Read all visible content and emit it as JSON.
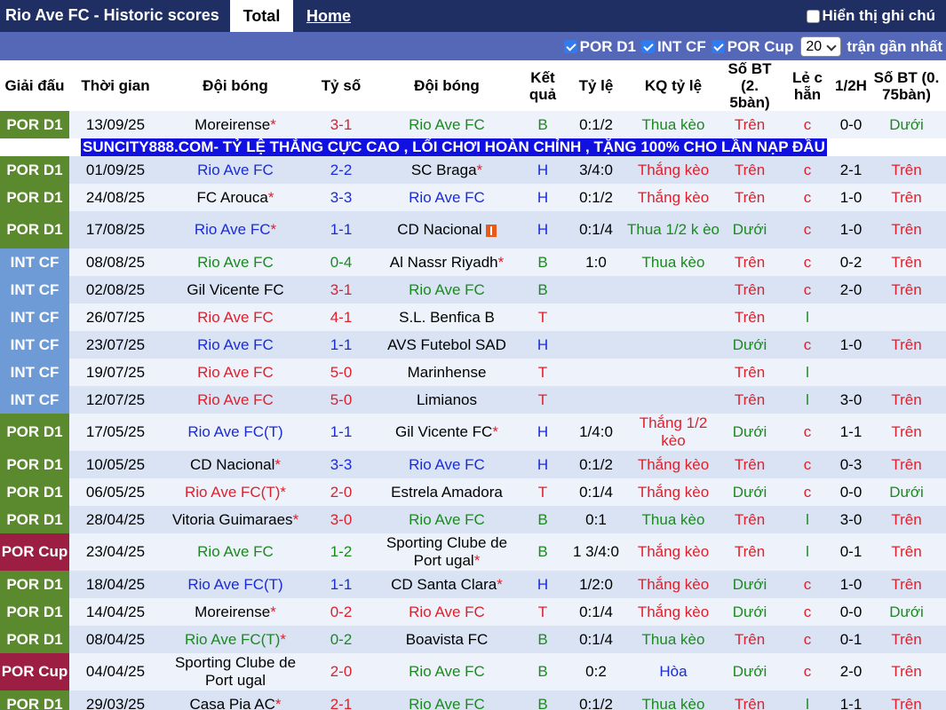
{
  "header": {
    "title": "Rio Ave FC - Historic scores",
    "tab_total": "Total",
    "tab_home": "Home",
    "notes_label": "Hiển thị ghi chú"
  },
  "filters": {
    "items": [
      "POR D1",
      "INT CF",
      "POR Cup"
    ],
    "count_value": "20",
    "count_suffix": "trận gần nhất"
  },
  "columns": [
    "Giải đấu",
    "Thời gian",
    "Đội bóng",
    "Tỷ số",
    "Đội bóng",
    "Kết quả",
    "Tỷ lệ",
    "KQ tỷ lệ",
    "Số BT (2. 5bàn)",
    "Lẻ c hẵn",
    "1/2H",
    "Số BT (0. 75bàn)"
  ],
  "ad_text": "SUNCITY888.COM- TỶ LỆ THẮNG CỰC CAO , LỐI CHƠI HOÀN CHỈNH , TẶNG 100% CHO LẦN NẠP ĐẦU",
  "colors": {
    "red": "#e01f2b",
    "blue": "#1a2bd8",
    "green": "#1a8a1e",
    "por": "#5b8a2e",
    "int": "#6e9ad6",
    "cup": "#9c1e42"
  },
  "rows": [
    {
      "league": "POR D1",
      "lt": "por",
      "date": "13/09/25",
      "home": "Moreirense",
      "hc": "black",
      "hstar": "*",
      "score": "3-1",
      "sc": "red",
      "away": "Rio Ave FC",
      "ac": "green",
      "astar": "",
      "res": "B",
      "rc": "green",
      "odds": "0:1/2",
      "kq": "Thua kèo",
      "kc": "green",
      "bt": "Trên",
      "bc": "red",
      "lc": "c",
      "lcc": "red",
      "half": "0-0",
      "bt2": "Dưới",
      "b2c": "green"
    },
    {
      "league": "POR D1",
      "lt": "por",
      "date": "01/09/25",
      "home": "Rio Ave FC",
      "hc": "blue",
      "hstar": "",
      "score": "2-2",
      "sc": "blue",
      "away": "SC Braga",
      "ac": "black",
      "astar": "*",
      "res": "H",
      "rc": "blue",
      "odds": "3/4:0",
      "kq": "Thắng kèo",
      "kc": "red",
      "bt": "Trên",
      "bc": "red",
      "lc": "c",
      "lcc": "red",
      "half": "2-1",
      "bt2": "Trên",
      "b2c": "red"
    },
    {
      "league": "POR D1",
      "lt": "por",
      "date": "24/08/25",
      "home": "FC Arouca",
      "hc": "black",
      "hstar": "*",
      "score": "3-3",
      "sc": "blue",
      "away": "Rio Ave FC",
      "ac": "blue",
      "astar": "",
      "res": "H",
      "rc": "blue",
      "odds": "0:1/2",
      "kq": "Thắng kèo",
      "kc": "red",
      "bt": "Trên",
      "bc": "red",
      "lc": "c",
      "lcc": "red",
      "half": "1-0",
      "bt2": "Trên",
      "b2c": "red"
    },
    {
      "league": "POR D1",
      "lt": "por",
      "date": "17/08/25",
      "home": "Rio Ave FC",
      "hc": "blue",
      "hstar": "*",
      "score": "1-1",
      "sc": "blue",
      "away": "CD Nacional",
      "ac": "black",
      "astar": "",
      "flag": true,
      "res": "H",
      "rc": "blue",
      "odds": "0:1/4",
      "kq": "Thua 1/2 k èo",
      "kc": "green",
      "bt": "Dưới",
      "bc": "green",
      "lc": "c",
      "lcc": "red",
      "half": "1-0",
      "bt2": "Trên",
      "b2c": "red",
      "tall": true
    },
    {
      "league": "INT CF",
      "lt": "int",
      "date": "08/08/25",
      "home": "Rio Ave FC",
      "hc": "green",
      "hstar": "",
      "score": "0-4",
      "sc": "green",
      "away": "Al Nassr Riyadh",
      "ac": "black",
      "astar": "*",
      "res": "B",
      "rc": "green",
      "odds": "1:0",
      "kq": "Thua kèo",
      "kc": "green",
      "bt": "Trên",
      "bc": "red",
      "lc": "c",
      "lcc": "red",
      "half": "0-2",
      "bt2": "Trên",
      "b2c": "red"
    },
    {
      "league": "INT CF",
      "lt": "int",
      "date": "02/08/25",
      "home": "Gil Vicente FC",
      "hc": "black",
      "hstar": "",
      "score": "3-1",
      "sc": "red",
      "away": "Rio Ave FC",
      "ac": "green",
      "astar": "",
      "res": "B",
      "rc": "green",
      "odds": "",
      "kq": "",
      "kc": "green",
      "bt": "Trên",
      "bc": "red",
      "lc": "c",
      "lcc": "red",
      "half": "2-0",
      "bt2": "Trên",
      "b2c": "red"
    },
    {
      "league": "INT CF",
      "lt": "int",
      "date": "26/07/25",
      "home": "Rio Ave FC",
      "hc": "red",
      "hstar": "",
      "score": "4-1",
      "sc": "red",
      "away": "S.L. Benfica B",
      "ac": "black",
      "astar": "",
      "res": "T",
      "rc": "red",
      "odds": "",
      "kq": "",
      "kc": "green",
      "bt": "Trên",
      "bc": "red",
      "lc": "l",
      "lcc": "green",
      "half": "",
      "bt2": "",
      "b2c": "red"
    },
    {
      "league": "INT CF",
      "lt": "int",
      "date": "23/07/25",
      "home": "Rio Ave FC",
      "hc": "blue",
      "hstar": "",
      "score": "1-1",
      "sc": "blue",
      "away": "AVS Futebol SAD",
      "ac": "black",
      "astar": "",
      "res": "H",
      "rc": "blue",
      "odds": "",
      "kq": "",
      "kc": "green",
      "bt": "Dưới",
      "bc": "green",
      "lc": "c",
      "lcc": "red",
      "half": "1-0",
      "bt2": "Trên",
      "b2c": "red"
    },
    {
      "league": "INT CF",
      "lt": "int",
      "date": "19/07/25",
      "home": "Rio Ave FC",
      "hc": "red",
      "hstar": "",
      "score": "5-0",
      "sc": "red",
      "away": "Marinhense",
      "ac": "black",
      "astar": "",
      "res": "T",
      "rc": "red",
      "odds": "",
      "kq": "",
      "kc": "green",
      "bt": "Trên",
      "bc": "red",
      "lc": "l",
      "lcc": "green",
      "half": "",
      "bt2": "",
      "b2c": "red"
    },
    {
      "league": "INT CF",
      "lt": "int",
      "date": "12/07/25",
      "home": "Rio Ave FC",
      "hc": "red",
      "hstar": "",
      "score": "5-0",
      "sc": "red",
      "away": "Limianos",
      "ac": "black",
      "astar": "",
      "res": "T",
      "rc": "red",
      "odds": "",
      "kq": "",
      "kc": "green",
      "bt": "Trên",
      "bc": "red",
      "lc": "l",
      "lcc": "green",
      "half": "3-0",
      "bt2": "Trên",
      "b2c": "red"
    },
    {
      "league": "POR D1",
      "lt": "por",
      "date": "17/05/25",
      "home": "Rio Ave FC(T)",
      "hc": "blue",
      "hstar": "",
      "score": "1-1",
      "sc": "blue",
      "away": "Gil Vicente FC",
      "ac": "black",
      "astar": "*",
      "res": "H",
      "rc": "blue",
      "odds": "1/4:0",
      "kq": "Thắng 1/2 kèo",
      "kc": "red",
      "bt": "Dưới",
      "bc": "green",
      "lc": "c",
      "lcc": "red",
      "half": "1-1",
      "bt2": "Trên",
      "b2c": "red",
      "tall": true
    },
    {
      "league": "POR D1",
      "lt": "por",
      "date": "10/05/25",
      "home": "CD Nacional",
      "hc": "black",
      "hstar": "*",
      "score": "3-3",
      "sc": "blue",
      "away": "Rio Ave FC",
      "ac": "blue",
      "astar": "",
      "res": "H",
      "rc": "blue",
      "odds": "0:1/2",
      "kq": "Thắng kèo",
      "kc": "red",
      "bt": "Trên",
      "bc": "red",
      "lc": "c",
      "lcc": "red",
      "half": "0-3",
      "bt2": "Trên",
      "b2c": "red"
    },
    {
      "league": "POR D1",
      "lt": "por",
      "date": "06/05/25",
      "home": "Rio Ave FC(T)",
      "hc": "red",
      "hstar": "*",
      "score": "2-0",
      "sc": "red",
      "away": "Estrela Amadora",
      "ac": "black",
      "astar": "",
      "res": "T",
      "rc": "red",
      "odds": "0:1/4",
      "kq": "Thắng kèo",
      "kc": "red",
      "bt": "Dưới",
      "bc": "green",
      "lc": "c",
      "lcc": "red",
      "half": "0-0",
      "bt2": "Dưới",
      "b2c": "green"
    },
    {
      "league": "POR D1",
      "lt": "por",
      "date": "28/04/25",
      "home": "Vitoria Guimaraes",
      "hc": "black",
      "hstar": "*",
      "score": "3-0",
      "sc": "red",
      "away": "Rio Ave FC",
      "ac": "green",
      "astar": "",
      "res": "B",
      "rc": "green",
      "odds": "0:1",
      "kq": "Thua kèo",
      "kc": "green",
      "bt": "Trên",
      "bc": "red",
      "lc": "l",
      "lcc": "green",
      "half": "3-0",
      "bt2": "Trên",
      "b2c": "red"
    },
    {
      "league": "POR Cup",
      "lt": "cup",
      "date": "23/04/25",
      "home": "Rio Ave FC",
      "hc": "green",
      "hstar": "",
      "score": "1-2",
      "sc": "green",
      "away": "Sporting Clube de Port ugal",
      "ac": "black",
      "astar": "*",
      "res": "B",
      "rc": "green",
      "odds": "1 3/4:0",
      "kq": "Thắng kèo",
      "kc": "red",
      "bt": "Trên",
      "bc": "red",
      "lc": "l",
      "lcc": "green",
      "half": "0-1",
      "bt2": "Trên",
      "b2c": "red",
      "tall": true
    },
    {
      "league": "POR D1",
      "lt": "por",
      "date": "18/04/25",
      "home": "Rio Ave FC(T)",
      "hc": "blue",
      "hstar": "",
      "score": "1-1",
      "sc": "blue",
      "away": "CD Santa Clara",
      "ac": "black",
      "astar": "*",
      "res": "H",
      "rc": "blue",
      "odds": "1/2:0",
      "kq": "Thắng kèo",
      "kc": "red",
      "bt": "Dưới",
      "bc": "green",
      "lc": "c",
      "lcc": "red",
      "half": "1-0",
      "bt2": "Trên",
      "b2c": "red"
    },
    {
      "league": "POR D1",
      "lt": "por",
      "date": "14/04/25",
      "home": "Moreirense",
      "hc": "black",
      "hstar": "*",
      "score": "0-2",
      "sc": "red",
      "away": "Rio Ave FC",
      "ac": "red",
      "astar": "",
      "res": "T",
      "rc": "red",
      "odds": "0:1/4",
      "kq": "Thắng kèo",
      "kc": "red",
      "bt": "Dưới",
      "bc": "green",
      "lc": "c",
      "lcc": "red",
      "half": "0-0",
      "bt2": "Dưới",
      "b2c": "green"
    },
    {
      "league": "POR D1",
      "lt": "por",
      "date": "08/04/25",
      "home": "Rio Ave FC(T)",
      "hc": "green",
      "hstar": "*",
      "score": "0-2",
      "sc": "green",
      "away": "Boavista FC",
      "ac": "black",
      "astar": "",
      "res": "B",
      "rc": "green",
      "odds": "0:1/4",
      "kq": "Thua kèo",
      "kc": "green",
      "bt": "Trên",
      "bc": "red",
      "lc": "c",
      "lcc": "red",
      "half": "0-1",
      "bt2": "Trên",
      "b2c": "red"
    },
    {
      "league": "POR Cup",
      "lt": "cup",
      "date": "04/04/25",
      "home": "Sporting Clube de Port ugal",
      "hc": "black",
      "hstar": "",
      "score": "2-0",
      "sc": "red",
      "away": "Rio Ave FC",
      "ac": "green",
      "astar": "",
      "res": "B",
      "rc": "green",
      "odds": "0:2",
      "kq": "Hòa",
      "kc": "blue",
      "bt": "Dưới",
      "bc": "green",
      "lc": "c",
      "lcc": "red",
      "half": "2-0",
      "bt2": "Trên",
      "b2c": "red",
      "tall": true
    },
    {
      "league": "POR D1",
      "lt": "por",
      "date": "29/03/25",
      "home": "Casa Pia AC",
      "hc": "black",
      "hstar": "*",
      "score": "2-1",
      "sc": "red",
      "away": "Rio Ave FC",
      "ac": "green",
      "astar": "",
      "res": "B",
      "rc": "green",
      "odds": "0:1/2",
      "kq": "Thua kèo",
      "kc": "green",
      "bt": "Trên",
      "bc": "red",
      "lc": "l",
      "lcc": "green",
      "half": "1-1",
      "bt2": "Trên",
      "b2c": "red"
    }
  ]
}
